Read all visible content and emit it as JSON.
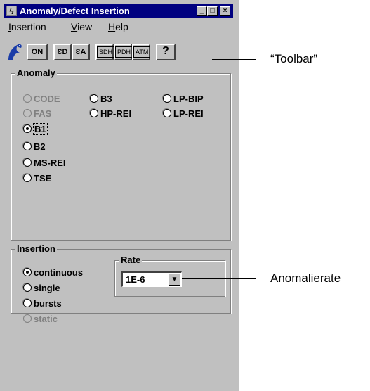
{
  "window": {
    "title": "Anomaly/Defect Insertion",
    "titlebar_buttons": {
      "minimize": "_",
      "maximize": "□",
      "close": "×"
    }
  },
  "menu": {
    "items": [
      {
        "label": "Insertion",
        "accel": "I",
        "rest": "nsertion"
      },
      {
        "label": "View",
        "accel": "V",
        "rest": "iew"
      },
      {
        "label": "Help",
        "accel": "H",
        "rest": "elp"
      }
    ]
  },
  "toolbar": {
    "on_label": "ON",
    "defect_label": "ƐD",
    "anomaly_label": "ƐA",
    "sdh_label": "SDH",
    "pdh_label": "PDH",
    "atm_label": "ATM",
    "help_glyph": "?",
    "logo_icon": "bird-logo-icon"
  },
  "anomaly": {
    "title": "Anomaly",
    "options": [
      {
        "label": "CODE",
        "enabled": false,
        "checked": false
      },
      {
        "label": "FAS",
        "enabled": false,
        "checked": false
      },
      {
        "label": "B1",
        "enabled": true,
        "checked": true
      },
      {
        "label": "B2",
        "enabled": true,
        "checked": false
      },
      {
        "label": "MS-REI",
        "enabled": true,
        "checked": false
      },
      {
        "label": "TSE",
        "enabled": true,
        "checked": false
      },
      {
        "label": "B3",
        "enabled": true,
        "checked": false
      },
      {
        "label": "HP-REI",
        "enabled": true,
        "checked": false
      },
      {
        "label": "LP-BIP",
        "enabled": true,
        "checked": false
      },
      {
        "label": "LP-REI",
        "enabled": true,
        "checked": false
      }
    ]
  },
  "insertion": {
    "title": "Insertion",
    "options": [
      {
        "label": "continuous",
        "enabled": true,
        "checked": true
      },
      {
        "label": "single",
        "enabled": true,
        "checked": false
      },
      {
        "label": "bursts",
        "enabled": true,
        "checked": false
      },
      {
        "label": "static",
        "enabled": false,
        "checked": false
      }
    ]
  },
  "rate": {
    "title": "Rate",
    "value": "1E-6"
  },
  "callouts": {
    "toolbar": "“Toolbar”",
    "rate": "Anomalierate"
  }
}
